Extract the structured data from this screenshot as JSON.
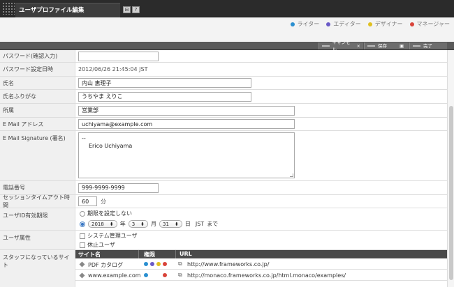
{
  "window": {
    "title": "ユーザプロファイル編集",
    "btn_back": "⊟",
    "btn_help": "?"
  },
  "legend": [
    {
      "label": "ライター",
      "color": "#2a8fd0"
    },
    {
      "label": "エディター",
      "color": "#6a5ac7"
    },
    {
      "label": "デザイナー",
      "color": "#e0c020"
    },
    {
      "label": "マネージャー",
      "color": "#d9443a"
    }
  ],
  "actions": {
    "cancel": "キャンセル",
    "cancel_x": "×",
    "save": "保存",
    "save_icon": "▣",
    "done": "完了"
  },
  "form": {
    "password_confirm": {
      "label": "パスワード(確認入力)",
      "value": ""
    },
    "password_date": {
      "label": "パスワード設定日時",
      "value": "2012/06/26 21:45:04 JST"
    },
    "name": {
      "label": "氏名",
      "value": "内山 恵理子"
    },
    "name_kana": {
      "label": "氏名ふりがな",
      "value": "うちやま えりこ"
    },
    "department": {
      "label": "所属",
      "value": "営業部"
    },
    "email": {
      "label": "E Mail アドレス",
      "value": "uchiyama@example.com"
    },
    "signature": {
      "label": "E Mail Signature (署名)",
      "line1": "--",
      "line2": "Erico Uchiyama"
    },
    "phone": {
      "label": "電話番号",
      "value": "999-9999-9999"
    },
    "session_timeout": {
      "label": "セッションタイムアウト時間",
      "value": "60",
      "unit": "分"
    },
    "expiry": {
      "label": "ユーザID有効期限",
      "option_none": "期限を設定しない",
      "year": "2018",
      "year_unit": "年",
      "month": "3",
      "month_unit": "月",
      "day": "31",
      "day_unit": "日",
      "tz": "JST",
      "until": "まで"
    },
    "attributes": {
      "label": "ユーザ属性",
      "system_admin": "システム管理ユーザ",
      "suspended": "休止ユーザ"
    },
    "sites": {
      "label": "スタッフになっているサイト",
      "col_site": "サイト名",
      "col_role": "権限",
      "col_url": "URL",
      "rows": [
        {
          "name": "PDF カタログ",
          "url": "http://www.frameworks.co.jp/"
        },
        {
          "name": "www.example.com",
          "url": "http://monaco.frameworks.co.jp/html.monaco/examples/"
        }
      ]
    }
  }
}
